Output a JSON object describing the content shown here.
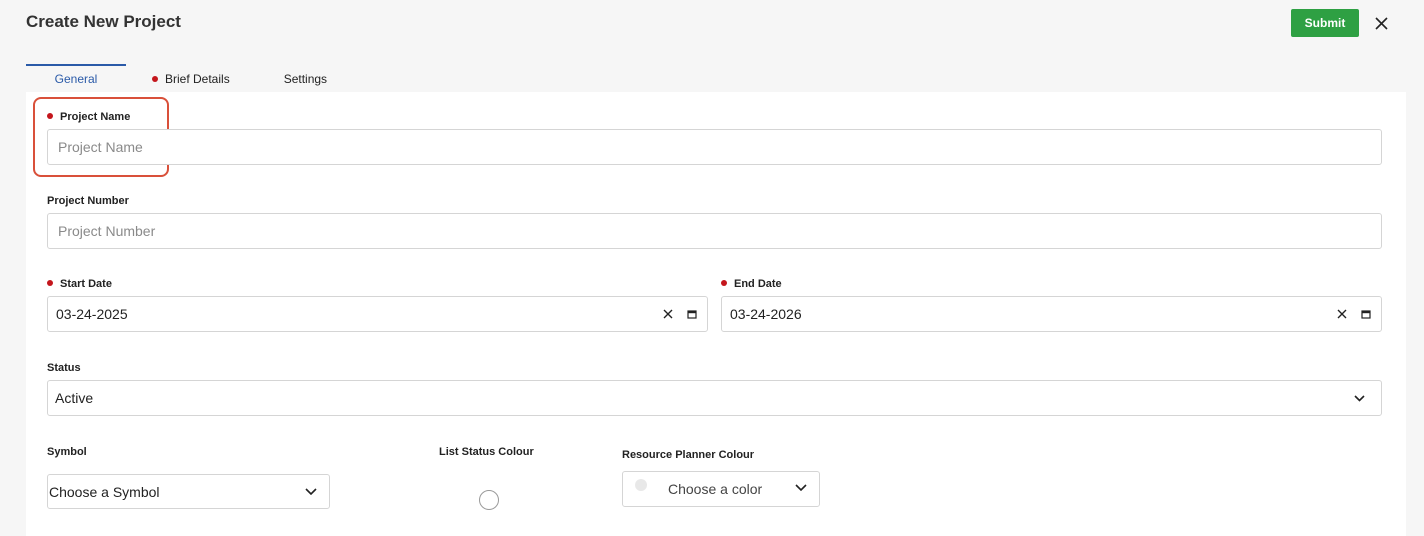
{
  "header": {
    "title": "Create New Project",
    "submit_label": "Submit"
  },
  "tabs": [
    {
      "label": "General",
      "active": true,
      "required": false
    },
    {
      "label": "Brief Details",
      "active": false,
      "required": true
    },
    {
      "label": "Settings",
      "active": false,
      "required": false
    }
  ],
  "form": {
    "project_name": {
      "label": "Project Name",
      "placeholder": "Project Name",
      "required": true
    },
    "project_number": {
      "label": "Project Number",
      "placeholder": "Project Number",
      "required": false
    },
    "start_date": {
      "label": "Start Date",
      "value": "03-24-2025",
      "required": true
    },
    "end_date": {
      "label": "End Date",
      "value": "03-24-2026",
      "required": true
    },
    "status": {
      "label": "Status",
      "value": "Active"
    },
    "symbol": {
      "label": "Symbol",
      "value": "Choose a Symbol"
    },
    "list_status_colour": {
      "label": "List Status Colour"
    },
    "resource_planner_colour": {
      "label": "Resource Planner Colour",
      "value": "Choose a color"
    }
  },
  "colors": {
    "accent": "#2a5aa8",
    "submit": "#2ea043",
    "required": "#c4161c",
    "highlight": "#d9503a"
  }
}
